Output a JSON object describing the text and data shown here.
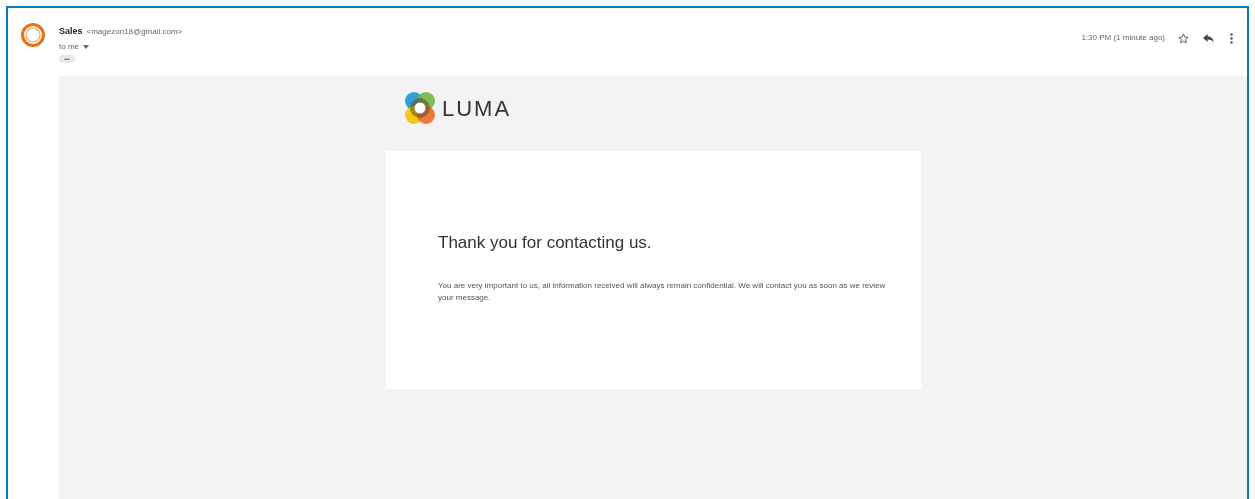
{
  "sender": {
    "name": "Sales",
    "email": "<magezon18@gmail.com>",
    "recipient": "to me",
    "trimmed": "•••"
  },
  "time": "1:30 PM (1 minute ago)",
  "starred": false,
  "email_body": {
    "logo_text": "LUMA",
    "heading": "Thank you for contacting us.",
    "message": "You are very important to us, all information received will always remain confidential. We will contact you as soon as we review your message."
  }
}
